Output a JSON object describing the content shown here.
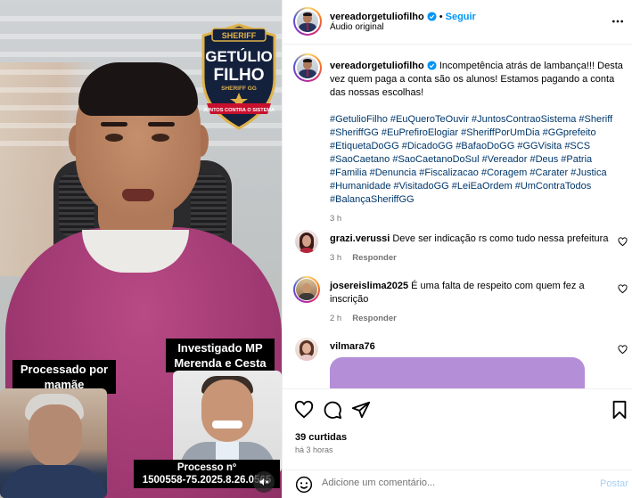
{
  "media": {
    "badge": {
      "top_word": "SHERIFF",
      "name_line1": "GETÚLIO",
      "name_line2": "FILHO",
      "sub": "SHERIFF GG",
      "ribbon": "JUNTOS CONTRA O SISTEMA"
    },
    "label_left": "Processado por mamãe",
    "label_right": "Investigado MP Merenda e Cesta",
    "process_title": "Processo nº",
    "process_number": "1500558-75.2025.8.26.0565"
  },
  "header": {
    "username": "vereadorgetuliofilho",
    "follow": "Seguir",
    "separator": "•",
    "audio": "Áudio original",
    "more_icon": "more-horizontal-icon"
  },
  "caption": {
    "username": "vereadorgetuliofilho",
    "text": "Incompetência atrás de lambança!!! Desta vez quem paga a conta são os alunos! Estamos pagando a conta das nossas escolhas!",
    "hashtags": "#GetulioFilho #EuQueroTeOuvir #JuntosContraoSistema #Sheriff #SheriffGG #EuPrefiroElogiar #SheriffPorUmDia #GGprefeito #EtiquetaDoGG #DicadoGG #BafaoDoGG #GGVisita #SCS #SaoCaetano #SaoCaetanoDoSul #Vereador #Deus #Patria #Familia #Denuncia #Fiscalizacao #Coragem #Carater #Justica #Humanidade #VisitadoGG #LeiEaOrdem #UmContraTodos #BalançaSheriffGG",
    "time": "3 h"
  },
  "comments": [
    {
      "username": "grazi.verussi",
      "text": "Deve ser indicação rs como tudo nessa prefeitura",
      "time": "3 h",
      "reply": "Responder"
    },
    {
      "username": "josereislima2025",
      "text": "É uma falta de respeito com quem fez a inscrição",
      "time": "2 h",
      "reply": "Responder"
    },
    {
      "username": "vilmara76",
      "text": "",
      "time": "",
      "reply": ""
    }
  ],
  "actions": {
    "likes": "39 curtidas",
    "time_ago": "há 3 horas"
  },
  "comment_bar": {
    "placeholder": "Adicione um comentário...",
    "post": "Postar"
  },
  "colors": {
    "link_blue": "#0095f6",
    "hashtag": "#00376b",
    "muted": "#737373",
    "shirt": "#a23a74",
    "comment_media": "#b48fd8"
  }
}
